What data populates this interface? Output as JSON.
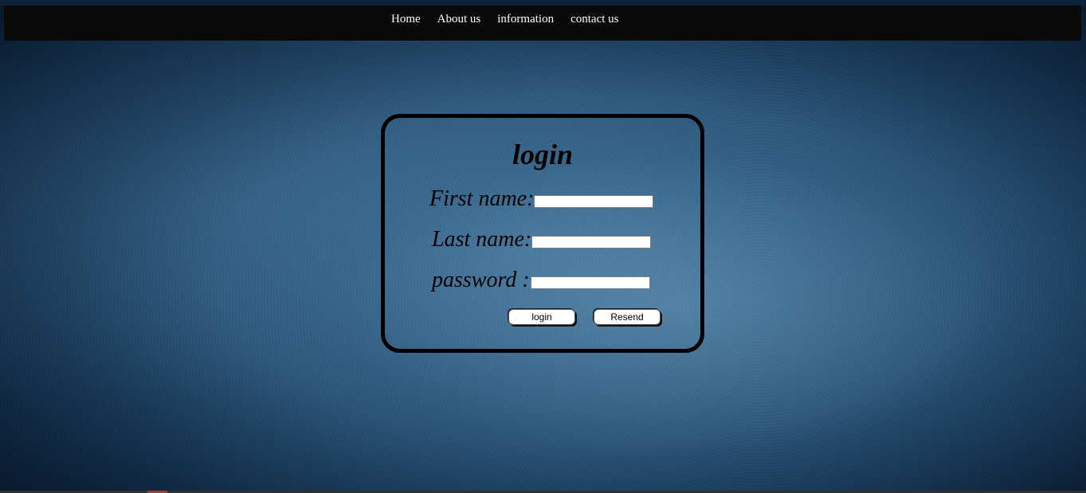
{
  "nav": {
    "items": [
      {
        "label": "Home"
      },
      {
        "label": "About us"
      },
      {
        "label": "information"
      },
      {
        "label": "contact us"
      }
    ]
  },
  "login_form": {
    "title": "login",
    "first_name_label": "First name:",
    "first_name_value": "",
    "last_name_label": "Last name:",
    "last_name_value": "",
    "password_label": "password :",
    "password_value": "",
    "login_button_label": "login",
    "resend_button_label": "Resend"
  },
  "colors": {
    "navbar_background": "#0a0a0a",
    "nav_text": "#ffffff",
    "page_background": "#2a5478",
    "login_box_border": "#000000"
  }
}
